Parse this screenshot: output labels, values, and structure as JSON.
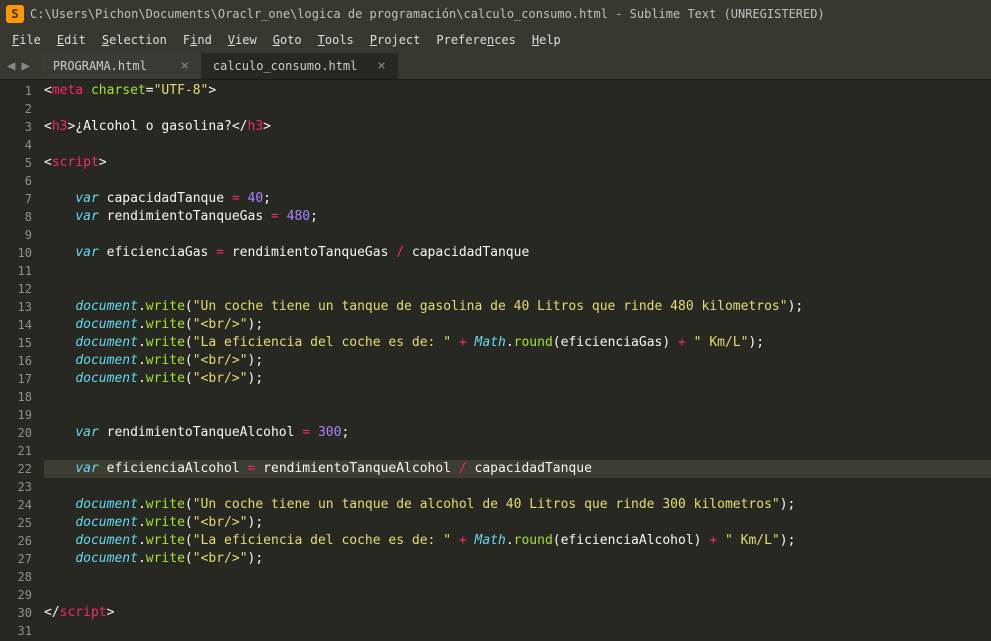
{
  "title": "C:\\Users\\Pichon\\Documents\\Oraclr_one\\logica de programación\\calculo_consumo.html - Sublime Text (UNREGISTERED)",
  "app_icon": "S",
  "menus": {
    "file": "File",
    "edit": "Edit",
    "selection": "Selection",
    "find": "Find",
    "view": "View",
    "goto": "Goto",
    "tools": "Tools",
    "project": "Project",
    "preferences": "Preferences",
    "help": "Help"
  },
  "nav": {
    "prev": "◀",
    "next": "▶"
  },
  "tabs": {
    "t0": {
      "label": "PROGRAMA.html",
      "close": "×"
    },
    "t1": {
      "label": "calculo_consumo.html",
      "close": "×"
    }
  },
  "line_nums": {
    "l1": "1",
    "l2": "2",
    "l3": "3",
    "l4": "4",
    "l5": "5",
    "l6": "6",
    "l7": "7",
    "l8": "8",
    "l9": "9",
    "l10": "10",
    "l11": "11",
    "l12": "12",
    "l13": "13",
    "l14": "14",
    "l15": "15",
    "l16": "16",
    "l17": "17",
    "l18": "18",
    "l19": "19",
    "l20": "20",
    "l21": "21",
    "l22": "22",
    "l23": "23",
    "l24": "24",
    "l25": "25",
    "l26": "26",
    "l27": "27",
    "l28": "28",
    "l29": "29",
    "l30": "30",
    "l31": "31"
  },
  "code": {
    "l1": {
      "s1": "<",
      "s2": "meta",
      "s3": " ",
      "s4": "charset",
      "s5": "=",
      "s6": "\"UTF-8\"",
      "s7": ">"
    },
    "l3": {
      "s1": "<",
      "s2": "h3",
      "s3": ">",
      "s4": "¿Alcohol o gasolina?",
      "s5": "</",
      "s6": "h3",
      "s7": ">"
    },
    "l5": {
      "s1": "<",
      "s2": "script",
      "s3": ">"
    },
    "l7": {
      "s1": "    ",
      "s2": "var",
      "s3": " capacidadTanque ",
      "s4": "=",
      "s5": " ",
      "s6": "40",
      "s7": ";"
    },
    "l8": {
      "s1": "    ",
      "s2": "var",
      "s3": " rendimientoTanqueGas ",
      "s4": "=",
      "s5": " ",
      "s6": "480",
      "s7": ";"
    },
    "l10": {
      "s1": "    ",
      "s2": "var",
      "s3": " eficienciaGas ",
      "s4": "=",
      "s5": " rendimientoTanqueGas ",
      "s6": "/",
      "s7": " capacidadTanque"
    },
    "l13": {
      "s1": "    ",
      "s2": "document",
      "s3": ".",
      "s4": "write",
      "s5": "(",
      "s6": "\"Un coche tiene un tanque de gasolina de 40 Litros que rinde 480 kilometros\"",
      "s7": ");"
    },
    "l14": {
      "s1": "    ",
      "s2": "document",
      "s3": ".",
      "s4": "write",
      "s5": "(",
      "s6": "\"<br/>\"",
      "s7": ");"
    },
    "l15": {
      "s1": "    ",
      "s2": "document",
      "s3": ".",
      "s4": "write",
      "s5": "(",
      "s6": "\"La eficiencia del coche es de: \"",
      "s7": " ",
      "s8": "+",
      "s9": " ",
      "s10": "Math",
      "s11": ".",
      "s12": "round",
      "s13": "(eficienciaGas) ",
      "s14": "+",
      "s15": " ",
      "s16": "\" Km/L\"",
      "s17": ");"
    },
    "l16": {
      "s1": "    ",
      "s2": "document",
      "s3": ".",
      "s4": "write",
      "s5": "(",
      "s6": "\"<br/>\"",
      "s7": ");"
    },
    "l17": {
      "s1": "    ",
      "s2": "document",
      "s3": ".",
      "s4": "write",
      "s5": "(",
      "s6": "\"<br/>\"",
      "s7": ");"
    },
    "l20": {
      "s1": "    ",
      "s2": "var",
      "s3": " rendimientoTanqueAlcohol ",
      "s4": "=",
      "s5": " ",
      "s6": "300",
      "s7": ";"
    },
    "l22": {
      "s1": "    ",
      "s2": "var",
      "s3": " eficienciaAlcohol ",
      "s4": "=",
      "s5": " rendimientoTanqueAlcohol ",
      "s6": "/",
      "s7": " capacidadTanque"
    },
    "l24": {
      "s1": "    ",
      "s2": "document",
      "s3": ".",
      "s4": "write",
      "s5": "(",
      "s6": "\"Un coche tiene un tanque de alcohol de 40 Litros que rinde 300 kilometros\"",
      "s7": ");"
    },
    "l25": {
      "s1": "    ",
      "s2": "document",
      "s3": ".",
      "s4": "write",
      "s5": "(",
      "s6": "\"<br/>\"",
      "s7": ");"
    },
    "l26": {
      "s1": "    ",
      "s2": "document",
      "s3": ".",
      "s4": "write",
      "s5": "(",
      "s6": "\"La eficiencia del coche es de: \"",
      "s7": " ",
      "s8": "+",
      "s9": " ",
      "s10": "Math",
      "s11": ".",
      "s12": "round",
      "s13": "(eficienciaAlcohol) ",
      "s14": "+",
      "s15": " ",
      "s16": "\" Km/L\"",
      "s17": ");"
    },
    "l27": {
      "s1": "    ",
      "s2": "document",
      "s3": ".",
      "s4": "write",
      "s5": "(",
      "s6": "\"<br/>\"",
      "s7": ");"
    },
    "l30": {
      "s1": "</",
      "s2": "script",
      "s3": ">"
    }
  }
}
